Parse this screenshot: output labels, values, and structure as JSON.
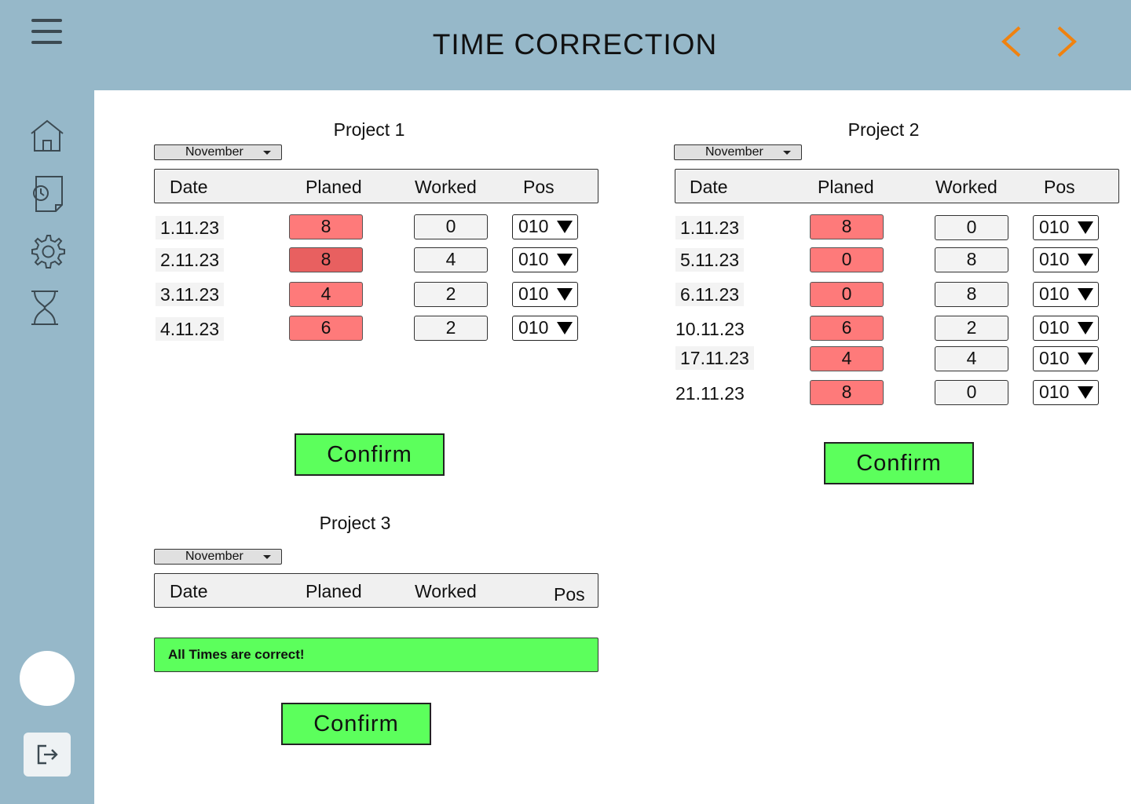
{
  "header": {
    "title": "TIME CORRECTION"
  },
  "colors": {
    "background": "#96b8c9",
    "planned": "#fe7a7a",
    "planned_dark": "#e86060",
    "confirm": "#5cff5c",
    "nav_arrows": "#f0820f"
  },
  "sidebar": {
    "icons": [
      "home-icon",
      "clock-document-icon",
      "gear-icon",
      "hourglass-icon"
    ]
  },
  "columns": {
    "date": "Date",
    "planned": "Planed",
    "worked": "Worked",
    "pos": "Pos"
  },
  "projects": [
    {
      "title": "Project 1",
      "month": "November",
      "confirm_label": "Confirm",
      "rows": [
        {
          "date": "1.11.23",
          "planned": "8",
          "worked": "0",
          "pos": "010"
        },
        {
          "date": "2.11.23",
          "planned": "8",
          "worked": "4",
          "pos": "010"
        },
        {
          "date": "3.11.23",
          "planned": "4",
          "worked": "2",
          "pos": "010"
        },
        {
          "date": "4.11.23",
          "planned": "6",
          "worked": "2",
          "pos": "010"
        }
      ]
    },
    {
      "title": "Project 2",
      "month": "November",
      "confirm_label": "Confirm",
      "rows": [
        {
          "date": "1.11.23",
          "planned": "8",
          "worked": "0",
          "pos": "010"
        },
        {
          "date": "5.11.23",
          "planned": "0",
          "worked": "8",
          "pos": "010"
        },
        {
          "date": "6.11.23",
          "planned": "0",
          "worked": "8",
          "pos": "010"
        },
        {
          "date": "10.11.23",
          "planned": "6",
          "worked": "2",
          "pos": "010"
        },
        {
          "date": "17.11.23",
          "planned": "4",
          "worked": "4",
          "pos": "010"
        },
        {
          "date": "21.11.23",
          "planned": "8",
          "worked": "0",
          "pos": "010"
        }
      ]
    },
    {
      "title": "Project 3",
      "month": "November",
      "confirm_label": "Confirm",
      "status_message": "All Times are correct!",
      "rows": []
    }
  ]
}
